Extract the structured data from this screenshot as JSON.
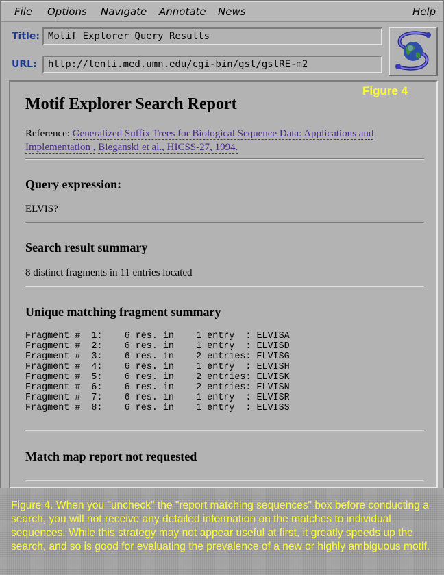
{
  "menubar": {
    "file": "File",
    "options": "Options",
    "navigate": "Navigate",
    "annotate": "Annotate",
    "news": "News",
    "help": "Help"
  },
  "title_row": {
    "label": "Title:",
    "value": "Motif Explorer Query Results"
  },
  "url_row": {
    "label": "URL:",
    "value": "http://lenti.med.umn.edu/cgi-bin/gst/gstRE-m2"
  },
  "figure_tag": "Figure 4",
  "report": {
    "heading": "Motif Explorer Search Report",
    "reference_prefix": "Reference: ",
    "reference_link_1": "Generalized Suffix Trees for Biological Sequence Data: Applications and Implementation ,",
    "reference_link_2": "Bieganski et al., HICSS-27, 1994.",
    "query_heading": "Query expression:",
    "query_value": "ELVIS?",
    "summary_heading": "Search result summary",
    "summary_value": "8 distinct fragments in 11 entries located",
    "fragments_heading": "Unique matching fragment summary",
    "fragments": [
      "Fragment #  1:    6 res. in    1 entry  : ELVISA",
      "Fragment #  2:    6 res. in    1 entry  : ELVISD",
      "Fragment #  3:    6 res. in    2 entries: ELVISG",
      "Fragment #  4:    6 res. in    1 entry  : ELVISH",
      "Fragment #  5:    6 res. in    2 entries: ELVISK",
      "Fragment #  6:    6 res. in    2 entries: ELVISN",
      "Fragment #  7:    6 res. in    1 entry  : ELVISR",
      "Fragment #  8:    6 res. in    1 entry  : ELVISS"
    ],
    "matchmap_heading": "Match map report not requested"
  },
  "caption": "Figure 4.  When you \"uncheck\" the \"report matching sequences\" box before conducting a search, you will not receive any detailed information on the matches to individual sequences.  While this strategy may not appear useful at first, it greatly speeds up the search, and so is good for evaluating the prevalence of a new or highly ambiguous motif.",
  "colors": {
    "caption_text": "#ffff33",
    "link": "#4a2a8a",
    "label": "#1d3a8a"
  },
  "icons": {
    "logo": "globe-s-logo-icon"
  }
}
